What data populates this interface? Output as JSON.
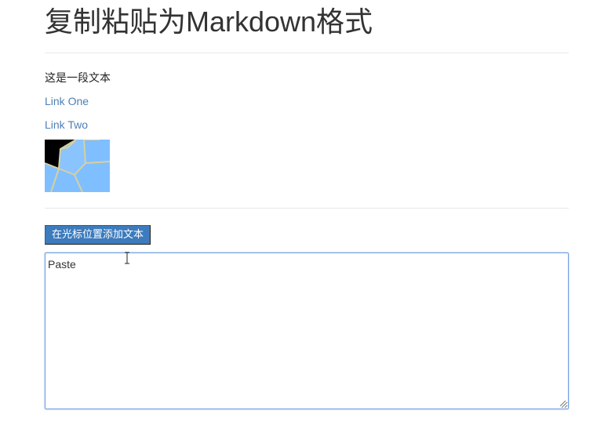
{
  "page": {
    "title": "复制粘贴为Markdown格式"
  },
  "content": {
    "paragraph": "这是一段文本",
    "links": [
      {
        "label": "Link One"
      },
      {
        "label": "Link Two"
      }
    ],
    "image_icon": "voronoi-cells-image"
  },
  "toolbar": {
    "insert_button_label": "在光标位置添加文本"
  },
  "editor": {
    "value": "Paste"
  },
  "colors": {
    "link": "#4f7fb8",
    "button": "#3c7bbd",
    "editor_border": "#6f9fe0",
    "image_cell": "#7fbfff",
    "image_dark": "#000000",
    "image_edge": "#d8cfa0"
  },
  "cursor_icon": "text-cursor-icon"
}
